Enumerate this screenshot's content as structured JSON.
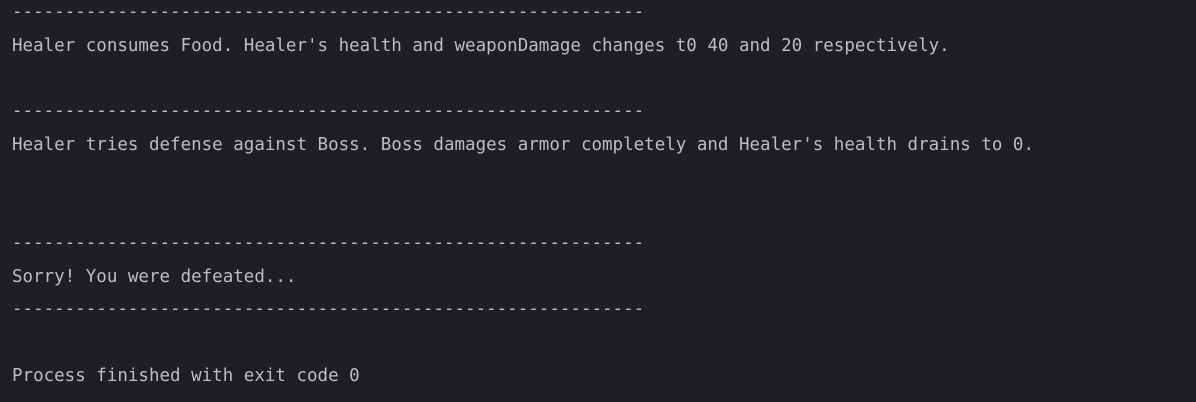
{
  "console": {
    "separator": "------------------------------------------------------------",
    "lines": [
      "------------------------------------------------------------",
      "Healer consumes Food. Healer's health and weaponDamage changes t0 40 and 20 respectively.",
      "",
      "------------------------------------------------------------",
      "Healer tries defense against Boss. Boss damages armor completely and Healer's health drains to 0.",
      "",
      "",
      "",
      "------------------------------------------------------------",
      "Sorry! You were defeated...",
      "------------------------------------------------------------",
      "",
      "Process finished with exit code 0"
    ]
  },
  "colors": {
    "background": "#1e1f22",
    "text": "#bcbec4"
  }
}
